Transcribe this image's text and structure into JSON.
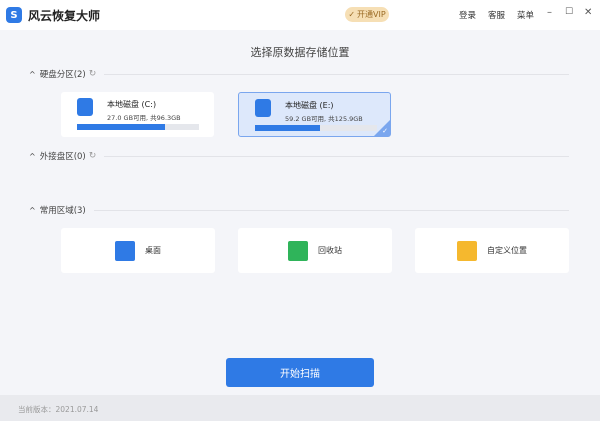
{
  "app": {
    "title": "风云恢复大师",
    "vip": "开通VIP",
    "login": "登录",
    "service": "客服",
    "menu": "菜单"
  },
  "heading": "选择原数据存储位置",
  "sections": {
    "disks": "硬盘分区(2)",
    "external": "外接盘区(0)",
    "common": "常用区域(3)"
  },
  "disks": [
    {
      "name": "本地磁盘 (C:)",
      "info": "27.0 GB可用, 共96.3GB",
      "used_pct": 72,
      "selected": false
    },
    {
      "name": "本地磁盘 (E:)",
      "info": "59.2 GB可用, 共125.9GB",
      "used_pct": 53,
      "selected": true
    }
  ],
  "areas": [
    {
      "label": "桌面",
      "icon": "windows-icon"
    },
    {
      "label": "回收站",
      "icon": "recycle-bin-icon"
    },
    {
      "label": "自定义位置",
      "icon": "folder-search-icon"
    }
  ],
  "scan": "开始扫描",
  "footer": "当前版本：2021.07.14",
  "colors": {
    "accent": "#2f7ae5",
    "vip": "#f6dfb5"
  }
}
